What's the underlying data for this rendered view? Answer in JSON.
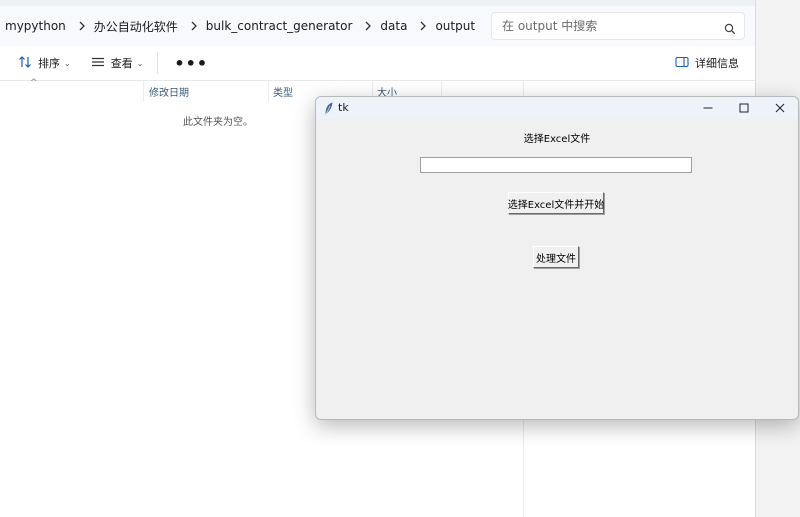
{
  "explorer": {
    "breadcrumbs": [
      "mypython",
      "办公自动化软件",
      "bulk_contract_generator",
      "data",
      "output"
    ],
    "search": {
      "placeholder": "在 output 中搜索"
    },
    "toolbar": {
      "sort_label": "排序",
      "view_label": "查看",
      "more_label": "•••",
      "details_label": "详细信息"
    },
    "columns": [
      "修改日期",
      "类型",
      "大小"
    ],
    "empty_message": "此文件夹为空。"
  },
  "tk_window": {
    "title": "tk",
    "label": "选择Excel文件",
    "entry_value": "",
    "select_button_label": "选择Excel文件并开始",
    "process_button_label": "处理文件"
  }
}
